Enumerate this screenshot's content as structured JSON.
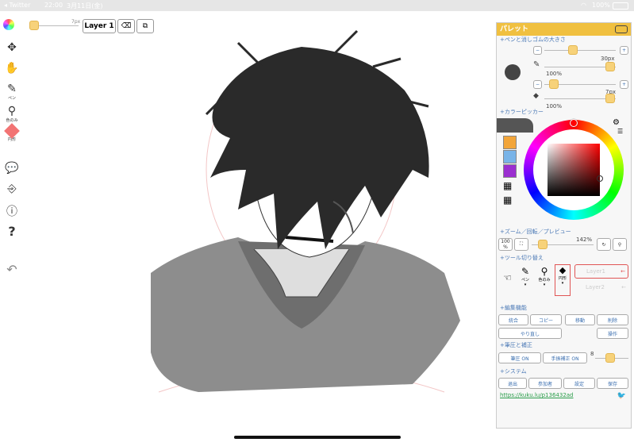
{
  "status": {
    "app": "◂ Twitter",
    "time": "22:00",
    "date": "3月11日(金)",
    "battery": "100%"
  },
  "topbar": {
    "brush_size_label": "7px",
    "layer_button": "Layer 1"
  },
  "lefttools": {
    "pen_label": "ペン",
    "color_only_label": "色のみ",
    "circle_label": "円形"
  },
  "panel": {
    "title": "パレット",
    "pen_eraser_section": "+ペンと消しゴムの大きさ",
    "pen_size": "30px",
    "pen_opacity": "100%",
    "eraser_size": "7px",
    "eraser_opacity": "100%",
    "color_picker_section": "+カラーピッカー",
    "swatches": [
      "#f2a53a",
      "#79b4e8",
      "#9b2fd0"
    ],
    "zoom_section": "+ズーム／回転／プレビュー",
    "zoom_100": "100",
    "zoom_pct_small": "%",
    "zoom_value": "142%",
    "tool_section": "+ツール切り替え",
    "tool_pen": "ペン",
    "tool_color_only": "色のみ",
    "tool_circle": "円形",
    "layer1": "Layer1",
    "layer2": "Layer2",
    "edit_section": "+編集機能",
    "btn_merge": "統合",
    "btn_copy": "コピー",
    "btn_move": "移動",
    "btn_delete": "削除",
    "btn_redo": "やり直し",
    "btn_operate": "操作",
    "pressure_section": "+筆圧と補正",
    "btn_pressure": "筆圧 ON",
    "btn_stabilizer": "手振補正 ON",
    "stabilizer_value": "8",
    "system_section": "+システム",
    "btn_exit": "退出",
    "btn_participants": "参加者",
    "btn_settings": "設定",
    "btn_save": "保存",
    "url": "https://kuku.lu/p136432ad"
  }
}
